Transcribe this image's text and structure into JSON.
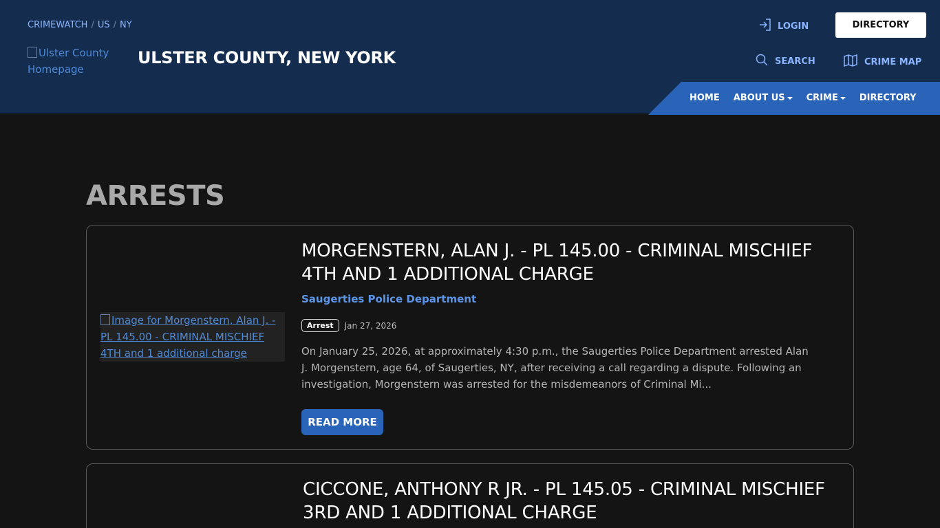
{
  "header": {
    "breadcrumb": [
      "CRIMEWATCH",
      "US",
      "NY"
    ],
    "logo_alt": "Ulster County Homepage",
    "site_title": "ULSTER COUNTY, NEW YORK",
    "login_label": "LOGIN",
    "directory_button_label": "DIRECTORY",
    "search_label": "SEARCH",
    "crime_map_label": "CRIME MAP",
    "nav": [
      {
        "label": "HOME",
        "dropdown": false
      },
      {
        "label": "ABOUT US",
        "dropdown": true
      },
      {
        "label": "CRIME",
        "dropdown": true
      },
      {
        "label": "DIRECTORY",
        "dropdown": false
      }
    ]
  },
  "page": {
    "title": "ARRESTS"
  },
  "posts": [
    {
      "title": "MORGENSTERN, ALAN J. - PL 145.00 - CRIMINAL MISCHIEF 4TH AND 1 ADDITIONAL CHARGE",
      "department": "Saugerties Police Department",
      "badge": "Arrest",
      "date": "Jan 27, 2026",
      "image_alt": "Image for Morgenstern, Alan J. - PL 145.00 - CRIMINAL MISCHIEF 4TH and 1 additional charge",
      "excerpt": "On January 25, 2026, at approximately 4:30 p.m., the Saugerties Police Department arrested Alan J. Morgenstern, age 64, of Saugerties, NY, after receiving a call regarding a dispute. Following an investigation, Morgenstern was arrested for the misdemeanors of  Criminal Mi...",
      "read_more": "READ MORE"
    },
    {
      "title": "CICCONE, ANTHONY R JR. - PL 145.05 - CRIMINAL MISCHIEF 3RD AND 1 ADDITIONAL CHARGE"
    }
  ],
  "colors": {
    "header_bg": "#142c4e",
    "accent": "#2a64b8",
    "page_bg": "#141414"
  }
}
